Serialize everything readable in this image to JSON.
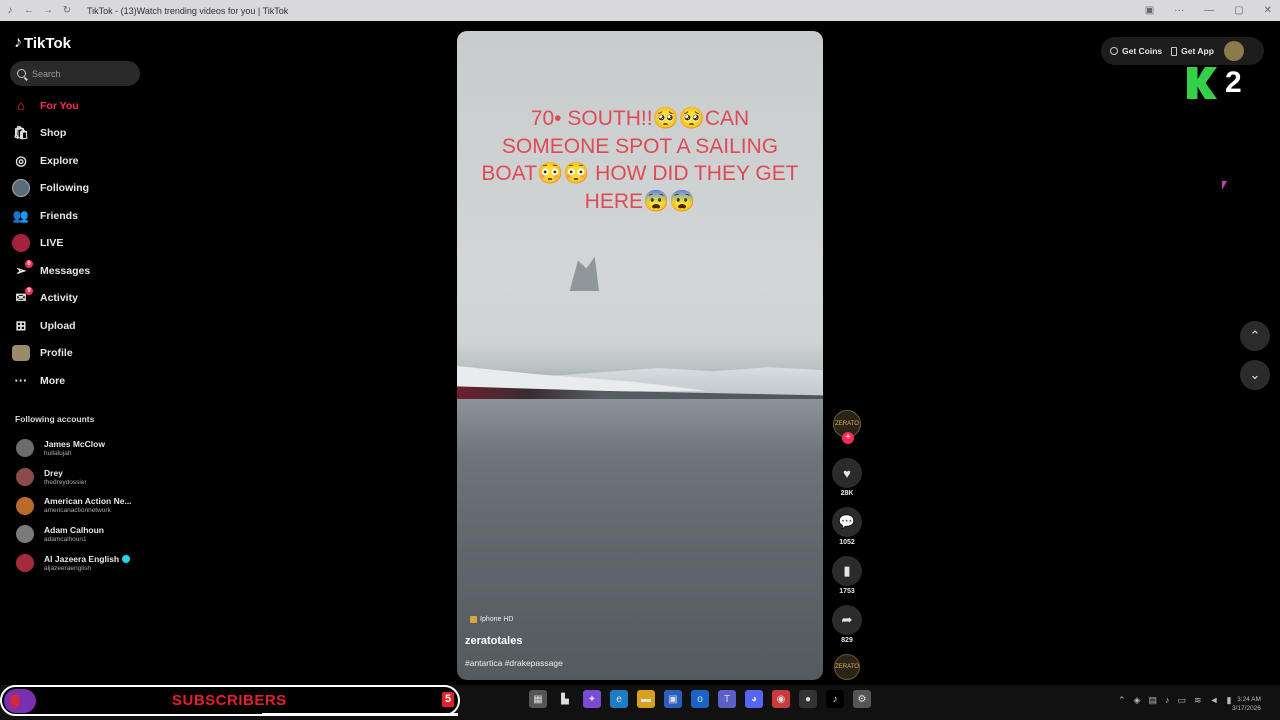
{
  "window": {
    "title": "TikTok - (13)Watch trending videos for you | TikTok"
  },
  "sidebar": {
    "logo": "TikTok",
    "search_placeholder": "Search",
    "nav": [
      {
        "label": "For You",
        "icon": "home-icon"
      },
      {
        "label": "Shop",
        "icon": "shop-bag-icon"
      },
      {
        "label": "Explore",
        "icon": "compass-icon"
      },
      {
        "label": "Following",
        "icon": "following-avatar-icon"
      },
      {
        "label": "Friends",
        "icon": "friends-icon"
      },
      {
        "label": "LIVE",
        "icon": "live-icon"
      },
      {
        "label": "Messages",
        "icon": "messages-icon",
        "badge": "6"
      },
      {
        "label": "Activity",
        "icon": "activity-icon",
        "badge": "9"
      },
      {
        "label": "Upload",
        "icon": "upload-icon"
      },
      {
        "label": "Profile",
        "icon": "profile-icon"
      },
      {
        "label": "More",
        "icon": "more-dots-icon"
      }
    ],
    "following_title": "Following accounts",
    "following": [
      {
        "name": "James McClow",
        "handle": "hullalujah"
      },
      {
        "name": "Drey",
        "handle": "thedreydossier"
      },
      {
        "name": "American Action Ne...",
        "handle": "americanactionnetwork"
      },
      {
        "name": "Adam Calhoun",
        "handle": "adamcalhoun1"
      },
      {
        "name": "Al Jazeera English",
        "handle": "aljazeeraenglish",
        "verified": true
      }
    ]
  },
  "video": {
    "caption": "70• SOUTH!!🥺🥺CAN SOMEONE SPOT A SAILING BOAT😳😳 HOW DID THEY GET HERE😨😨",
    "device_label": "Iphone HD",
    "username": "zeratotales",
    "hashtags": "#antartica #drakepassage"
  },
  "actions": {
    "creator_avatar_text": "ZERATO",
    "likes": "28K",
    "comments": "1052",
    "saves": "1753",
    "shares": "829"
  },
  "topbar": {
    "get_coins": "Get Coins",
    "get_app": "Get App"
  },
  "overlay": {
    "k_count": "2",
    "subscribers_label": "SUBSCRIBERS",
    "subscribers_count": "5"
  },
  "taskbar": {
    "clock_time": "3:24 AM",
    "clock_date": "3/17/2026"
  }
}
